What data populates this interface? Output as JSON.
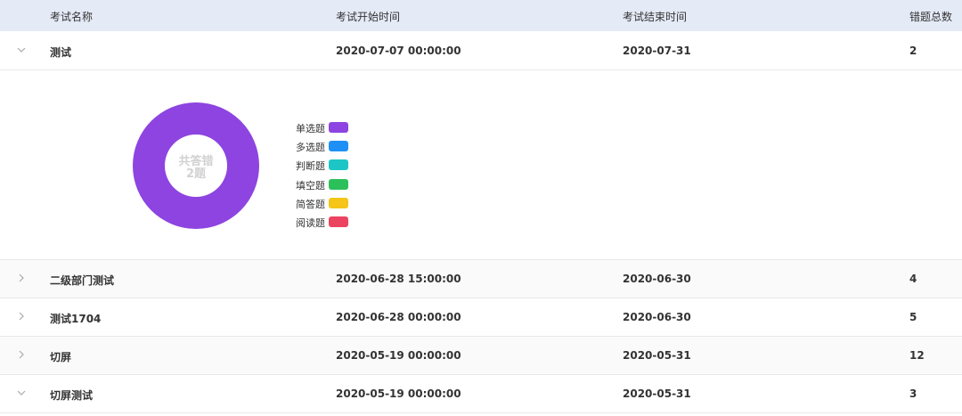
{
  "table": {
    "columns": [
      "考试名称",
      "考试开始时间",
      "考试结束时间",
      "错题总数"
    ],
    "rows": [
      {
        "name": "测试",
        "start": "2020-07-07 00:00:00",
        "end": "2020-07-31",
        "count": "2",
        "expanded": true
      },
      {
        "name": "二级部门测试",
        "start": "2020-06-28 15:00:00",
        "end": "2020-06-30",
        "count": "4",
        "expanded": false
      },
      {
        "name": "测试1704",
        "start": "2020-06-28 00:00:00",
        "end": "2020-06-30",
        "count": "5",
        "expanded": false
      },
      {
        "name": "切屏",
        "start": "2020-05-19 00:00:00",
        "end": "2020-05-31",
        "count": "12",
        "expanded": false
      },
      {
        "name": "切屏测试",
        "start": "2020-05-19 00:00:00",
        "end": "2020-05-31",
        "count": "3",
        "expanded": true
      }
    ]
  },
  "detail": {
    "center_line1": "共答错",
    "center_line2": "2题",
    "legend": [
      {
        "label": "单选题",
        "color": "#8e44e0"
      },
      {
        "label": "多选题",
        "color": "#1e90f5"
      },
      {
        "label": "判断题",
        "color": "#1cc6c6"
      },
      {
        "label": "填空题",
        "color": "#2cc05a"
      },
      {
        "label": "简答题",
        "color": "#f5c518"
      },
      {
        "label": "阅读题",
        "color": "#ec4460"
      }
    ],
    "slices": [
      {
        "type": "单选题",
        "value": 2
      }
    ]
  },
  "colors": {
    "header_bg": "#e4eaf6",
    "row_alt_bg": "#fafafa",
    "arrow": "#aaaaaa"
  },
  "icons": {
    "collapsed": "chevron-right-icon",
    "expanded": "chevron-down-icon"
  }
}
